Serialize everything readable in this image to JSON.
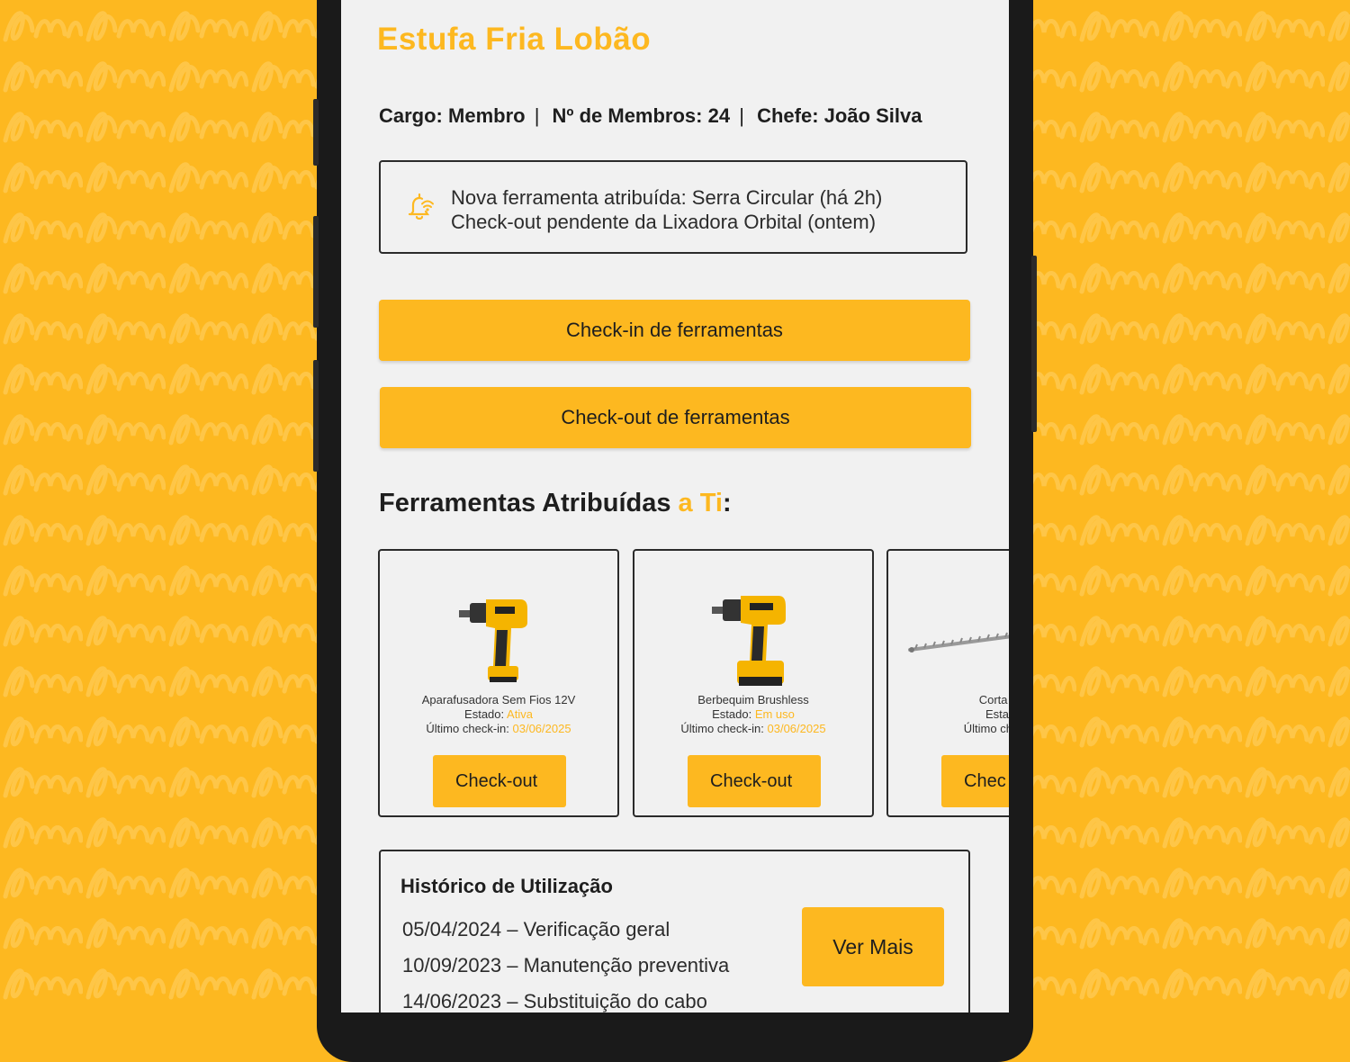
{
  "header": {
    "title": "Estufa Fria Lobão"
  },
  "meta": {
    "role_label": "Cargo:",
    "role_value": "Membro",
    "members_label": "Nº de Membros:",
    "members_value": "24",
    "chief_label": "Chefe:",
    "chief_value": "João Silva",
    "separator": "|"
  },
  "notifications": {
    "icon": "bell-wifi-icon",
    "lines": [
      "Nova ferramenta atribuída: Serra Circular (há 2h)",
      "Check-out pendente da Lixadora Orbital (ontem)"
    ]
  },
  "actions": {
    "checkin_label": "Check-in de ferramentas",
    "checkout_label": "Check-out de ferramentas"
  },
  "assigned": {
    "title_main": "Ferramentas Atribuídas ",
    "title_accent": "a Ti",
    "title_colon": ":",
    "state_label": "Estado:",
    "last_checkin_label": "Último check-in:",
    "tools": [
      {
        "name": "Aparafusadora Sem Fios 12V",
        "state": "Ativa",
        "last_checkin": "03/06/2025",
        "button": "Check-out",
        "icon": "screwdriver-drill-icon"
      },
      {
        "name": "Berbequim Brushless",
        "state": "Em uso",
        "last_checkin": "03/06/2025",
        "button": "Check-out",
        "icon": "hammer-drill-icon"
      },
      {
        "name": "Corta Seb",
        "state": "",
        "last_checkin": "",
        "button": "Chec",
        "icon": "hedge-trimmer-icon"
      }
    ]
  },
  "history": {
    "title": "Histórico de Utilização",
    "items": [
      "05/04/2024 – Verificação geral",
      "10/09/2023 – Manutenção preventiva",
      "14/06/2023 – Substituição do cabo"
    ],
    "more_label": "Ver Mais"
  },
  "colors": {
    "accent": "#FDB820",
    "screen_bg": "#F1F1F1",
    "text": "#1E1E1E",
    "frame": "#1A1A1A"
  }
}
